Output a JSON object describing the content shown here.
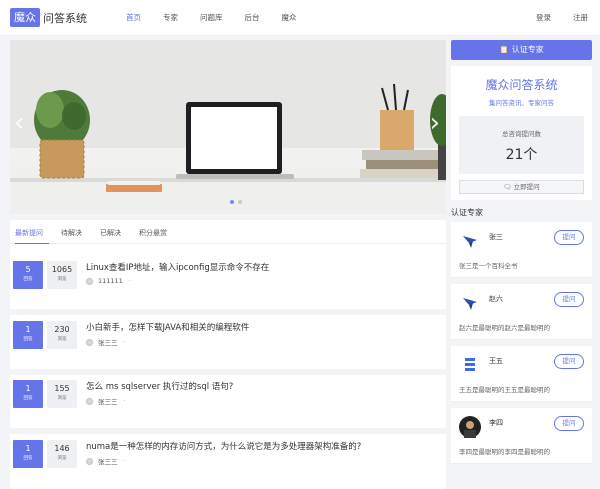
{
  "header": {
    "logo_box": "魔众",
    "logo_text": "问答系统",
    "nav": [
      "首页",
      "专家",
      "问题库",
      "后台",
      "魔众"
    ],
    "login": "登录",
    "register": "注册"
  },
  "banner": {
    "prev": "‹",
    "next": "›"
  },
  "tabs": [
    "最新提问",
    "待解决",
    "已解决",
    "积分悬赏"
  ],
  "questions": [
    {
      "answers": "5",
      "answers_label": "回答",
      "views": "1065",
      "views_label": "浏览",
      "title": "Linux查看IP地址，输入ipconfig显示命令不存在",
      "author": "111111",
      "meta_dot": "·"
    },
    {
      "answers": "1",
      "answers_label": "回答",
      "views": "230",
      "views_label": "浏览",
      "title": "小白新手，怎样下载JAVA和相关的编程软件",
      "author": "张三三",
      "meta_dot": "·"
    },
    {
      "answers": "1",
      "answers_label": "回答",
      "views": "155",
      "views_label": "浏览",
      "title": "怎么 ms sqlserver 执行过的sql 语句?",
      "author": "张三三",
      "meta_dot": "·"
    },
    {
      "answers": "1",
      "answers_label": "回答",
      "views": "146",
      "views_label": "浏览",
      "title": "numa是一种怎样的内存访问方式，为什么说它是为多处理器架构准备的?",
      "author": "张三三",
      "meta_dot": "·"
    }
  ],
  "sidebar": {
    "cert_button": "认证专家",
    "site_title": "魔众问答系统",
    "site_sub": "集问答资讯、专家问答",
    "count_label": "总咨询提问数",
    "count_value": "21个",
    "ask_button": "立即提问",
    "experts_title": "认证专家",
    "experts": [
      {
        "name": "张三",
        "desc": "张三是一个百科全书",
        "button": "提问"
      },
      {
        "name": "赵六",
        "desc": "赵六是最聪明的赵六是最聪明的",
        "button": "提问"
      },
      {
        "name": "王五",
        "desc": "王五是最聪明的王五是最聪明的",
        "button": "提问"
      },
      {
        "name": "李四",
        "desc": "李四是最聪明的李四是最聪明的",
        "button": "提问"
      }
    ]
  },
  "colors": {
    "accent": "#6574e8",
    "background": "#f3f4f8"
  }
}
